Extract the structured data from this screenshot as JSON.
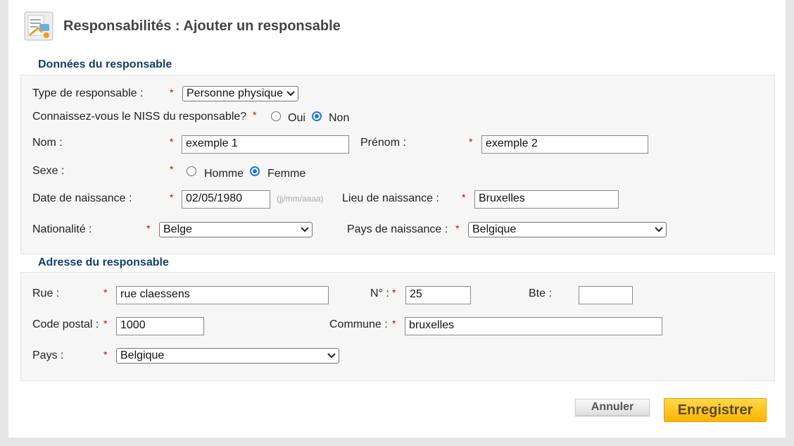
{
  "header": {
    "title": "Responsabilités : Ajouter un responsable",
    "icon": "form-document-icon"
  },
  "sections": {
    "donnees_title": "Données du responsable",
    "adresse_title": "Adresse du responsable"
  },
  "donnees": {
    "type_label": "Type de responsable :",
    "type_value": "Personne physique",
    "niss_label": "Connaissez-vous le NISS du responsable?",
    "niss_oui": "Oui",
    "niss_non": "Non",
    "niss_selected": "Non",
    "nom_label": "Nom :",
    "nom_value": "exemple 1",
    "prenom_label": "Prénom :",
    "prenom_value": "exemple 2",
    "sexe_label": "Sexe :",
    "sexe_homme": "Homme",
    "sexe_femme": "Femme",
    "sexe_selected": "Femme",
    "naissance_label": "Date de naissance :",
    "naissance_value": "02/05/1980",
    "naissance_hint": "(jj/mm/aaaa)",
    "lieu_label": "Lieu de naissance :",
    "lieu_value": "Bruxelles",
    "nationalite_label": "Nationalité :",
    "nationalite_value": "Belge",
    "pays_naissance_label": "Pays de naissance :",
    "pays_naissance_value": "Belgique"
  },
  "adresse": {
    "rue_label": "Rue :",
    "rue_value": "rue claessens",
    "num_label": "N° :",
    "num_value": "25",
    "bte_label": "Bte :",
    "bte_value": "",
    "cp_label": "Code postal :",
    "cp_value": "1000",
    "commune_label": "Commune :",
    "commune_value": "bruxelles",
    "pays_label": "Pays :",
    "pays_value": "Belgique"
  },
  "required_marker": "*",
  "actions": {
    "cancel_label": "Annuler",
    "save_label": "Enregistrer"
  },
  "colors": {
    "section_title": "#123f6b",
    "required": "#d60000",
    "radio_checked": "#1a73e8",
    "save_button": "#ffb400"
  }
}
